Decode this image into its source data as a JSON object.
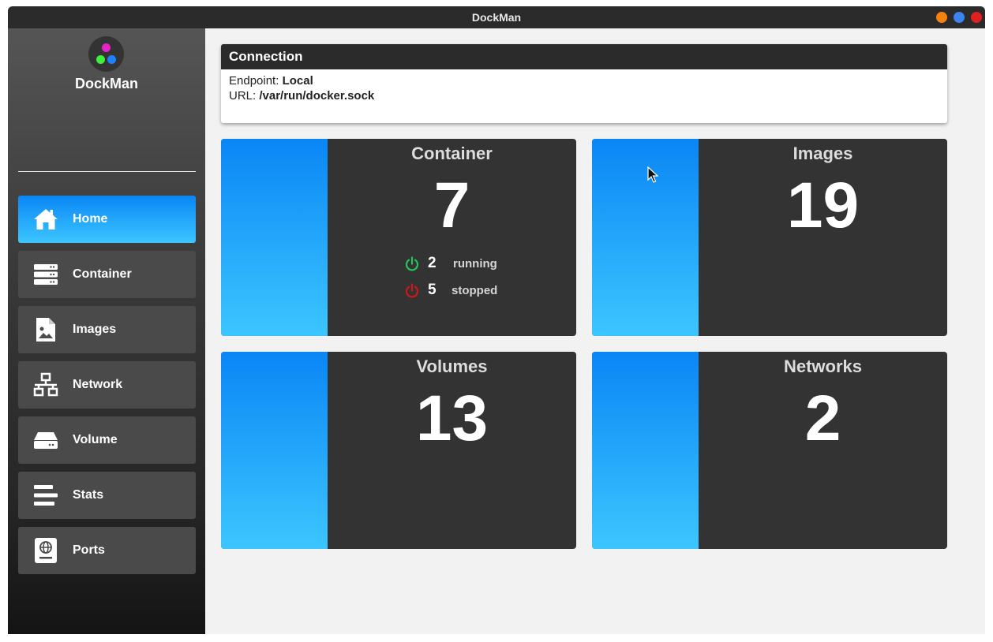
{
  "window": {
    "title": "DockMan"
  },
  "sidebar": {
    "app_name": "DockMan",
    "items": [
      {
        "label": "Home",
        "icon": "home-icon",
        "active": true
      },
      {
        "label": "Container",
        "icon": "server-icon"
      },
      {
        "label": "Images",
        "icon": "image-file-icon"
      },
      {
        "label": "Network",
        "icon": "network-icon"
      },
      {
        "label": "Volume",
        "icon": "hard-drive-icon"
      },
      {
        "label": "Stats",
        "icon": "stats-bars-icon"
      },
      {
        "label": "Ports",
        "icon": "passport-icon"
      }
    ]
  },
  "connection": {
    "title": "Connection",
    "endpoint_label": "Endpoint:",
    "endpoint_value": "Local",
    "url_label": "URL:",
    "url_value": "/var/run/docker.sock"
  },
  "cards": {
    "container": {
      "title": "Container",
      "count": "7",
      "running_count": "2",
      "running_label": "running",
      "stopped_count": "5",
      "stopped_label": "stopped"
    },
    "images": {
      "title": "Images",
      "count": "19"
    },
    "volumes": {
      "title": "Volumes",
      "count": "13"
    },
    "networks": {
      "title": "Networks",
      "count": "2"
    }
  },
  "colors": {
    "accent_gradient_top": "#0a86f5",
    "accent_gradient_bottom": "#3cc6ff",
    "running": "#22c55e",
    "stopped": "#d01818",
    "close_button": "#e02020",
    "minimize_button": "#f5820f",
    "maximize_button": "#3b83f0"
  }
}
